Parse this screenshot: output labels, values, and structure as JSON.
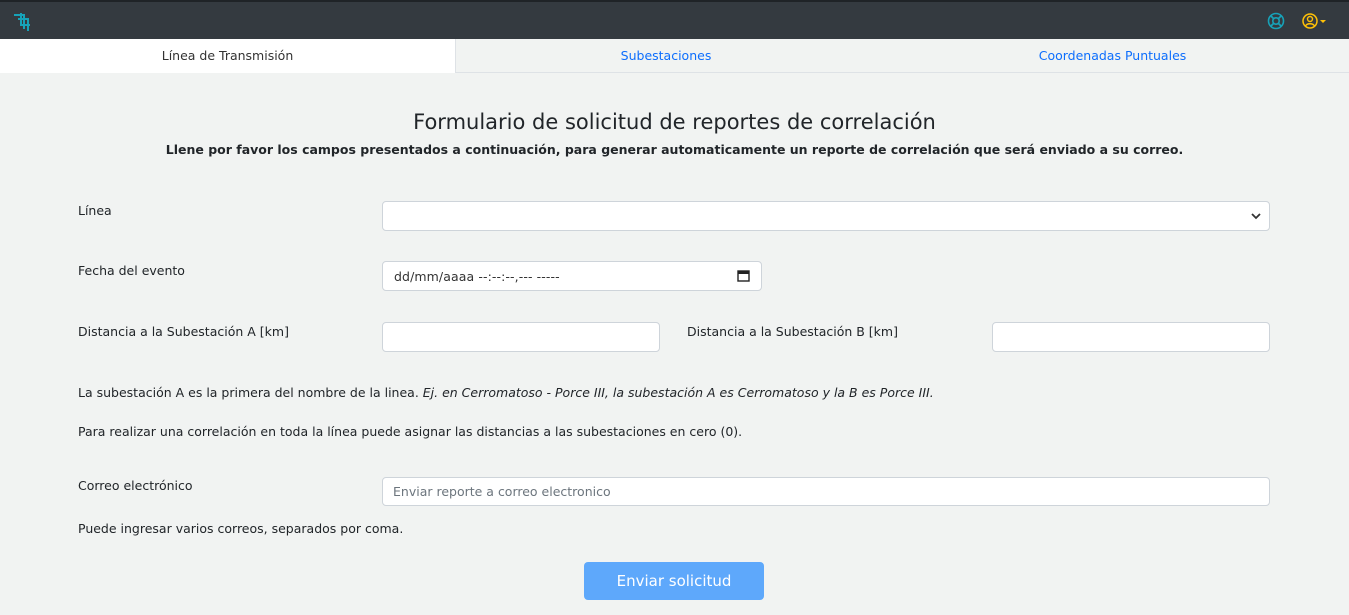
{
  "navbar": {
    "logo_icon": "app-logo-icon",
    "help_icon": "lifebuoy-icon",
    "user_icon": "user-circle-icon",
    "accent_color": "#17a2b8",
    "user_color": "#ffc107"
  },
  "tabs": [
    {
      "label": "Línea de Transmisión",
      "active": true
    },
    {
      "label": "Subestaciones",
      "active": false
    },
    {
      "label": "Coordenadas Puntuales",
      "active": false
    }
  ],
  "form": {
    "title": "Formulario de solicitud de reportes de correlación",
    "subtitle": "Llene por favor los campos presentados a continuación, para generar automaticamente un reporte de correlación que será enviado a su correo.",
    "linea_label": "Línea",
    "linea_value": "",
    "fecha_label": "Fecha del evento",
    "fecha_value": "dd/mm/aaaa --:--:--,--- -----",
    "dist_a_label": "Distancia a la Subestación A [km]",
    "dist_a_value": "",
    "dist_b_label": "Distancia a la Subestación B [km]",
    "dist_b_value": "",
    "note_1_plain": "La subestación A es la primera del nombre de la linea. ",
    "note_1_italic": "Ej. en Cerromatoso - Porce III, la subestación A es Cerromatoso y la B es Porce III.",
    "note_2": "Para realizar una correlación en toda la línea puede asignar las distancias a las subestaciones en cero (0).",
    "email_label": "Correo electrónico",
    "email_placeholder": "Enviar reporte a correo electronico",
    "email_note": "Puede ingresar varios correos, separados por coma.",
    "submit_label": "Enviar solicitud"
  }
}
